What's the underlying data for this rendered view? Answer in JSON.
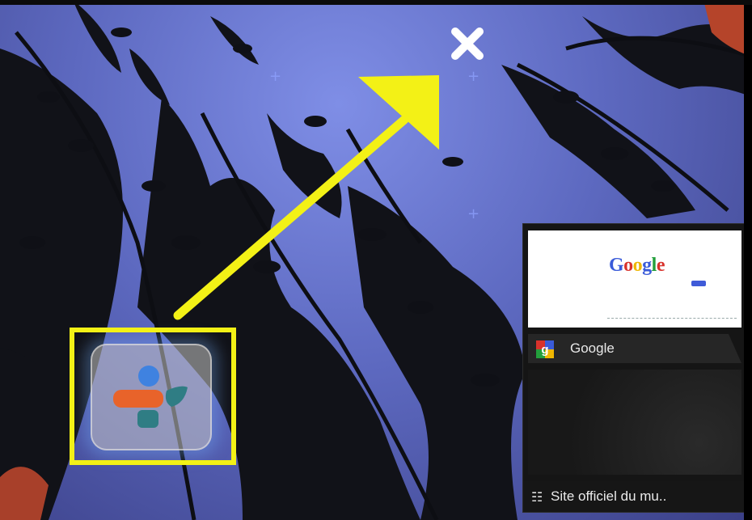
{
  "desktop": {
    "remove_target": {
      "icon": "close-icon",
      "color": "#ffffff"
    },
    "annotation": {
      "arrow_color": "#f3f116",
      "highlight_color": "#f3f116"
    },
    "app_icon": {
      "icon": "google-currents-icon",
      "colors": [
        "#3f82e0",
        "#e8632a",
        "#2f7d84"
      ]
    }
  },
  "browser_widget": {
    "preview": {
      "logo_letters": [
        "G",
        "o",
        "o",
        "g",
        "l",
        "e"
      ],
      "logo_colors": [
        "#3a5bd9",
        "#d8322c",
        "#efb600",
        "#3a5bd9",
        "#239f3c",
        "#d8322c"
      ]
    },
    "tab": {
      "title": "Google",
      "icon": "google-favicon-icon"
    },
    "bookmark": {
      "label": "Site officiel du mu..",
      "icon": "accessibility-icon"
    }
  }
}
